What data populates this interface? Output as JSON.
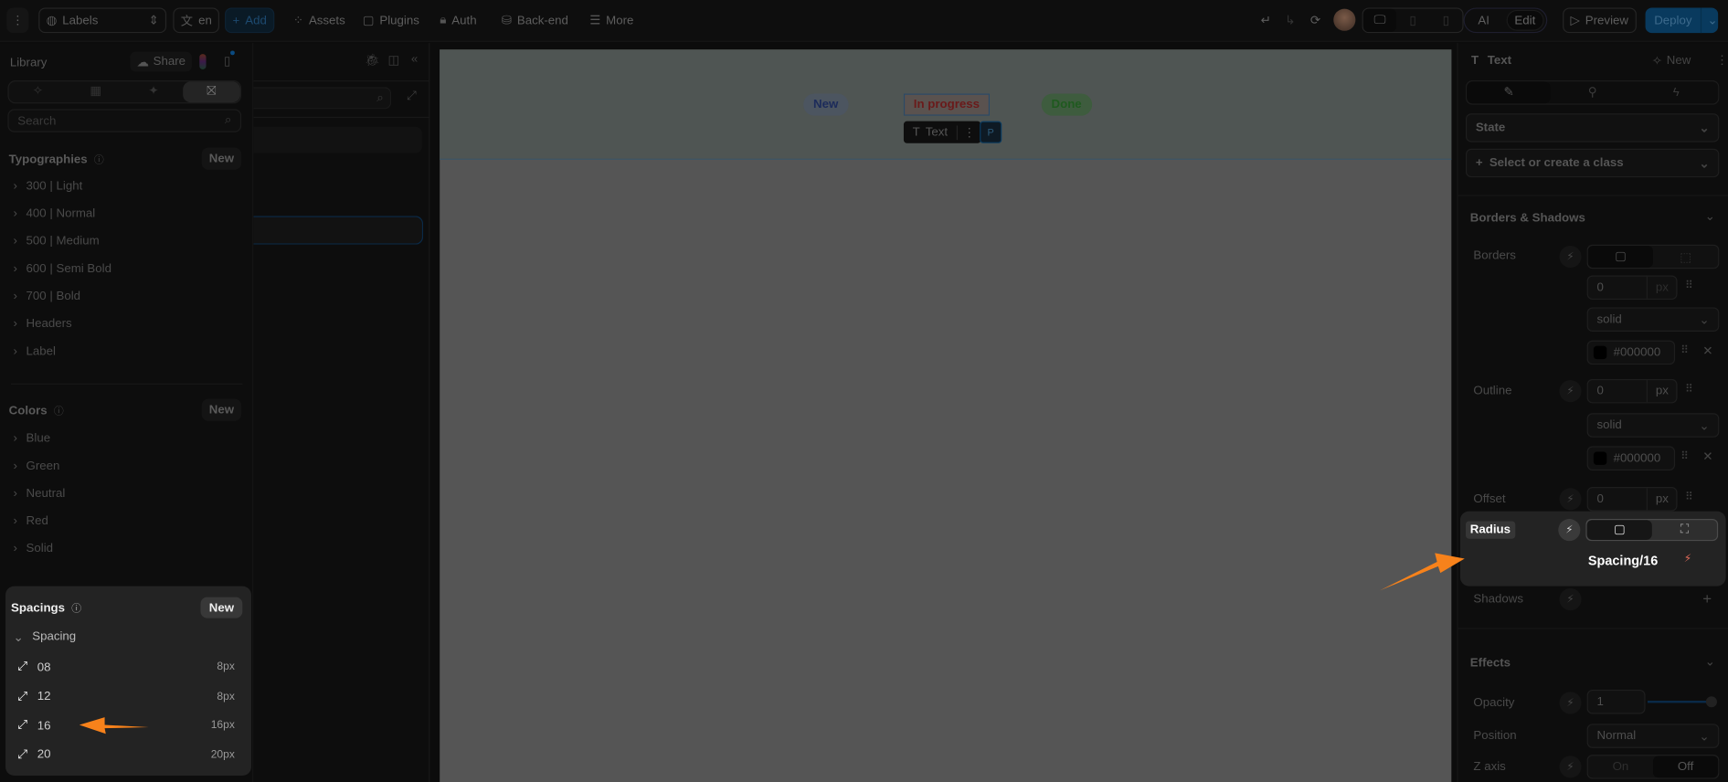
{
  "topbar": {
    "page_select": "Labels",
    "lang": "en",
    "add": "Add",
    "assets": "Assets",
    "plugins": "Plugins",
    "auth": "Auth",
    "backend": "Back-end",
    "more": "More",
    "ai": "AI",
    "edit": "Edit",
    "preview": "Preview",
    "deploy": "Deploy"
  },
  "library": {
    "title": "Library",
    "share": "Share",
    "search_placeholder": "Search",
    "typographies": {
      "title": "Typographies",
      "new": "New",
      "items": [
        "300 | Light",
        "400 | Normal",
        "500 | Medium",
        "600 | Semi Bold",
        "700 | Bold",
        "Headers",
        "Label"
      ]
    },
    "colors": {
      "title": "Colors",
      "new": "New",
      "items": [
        "Blue",
        "Green",
        "Neutral",
        "Red",
        "Solid"
      ]
    },
    "spacings": {
      "title": "Spacings",
      "new": "New",
      "group": "Spacing",
      "items": [
        {
          "name": "08",
          "value": "8px"
        },
        {
          "name": "12",
          "value": "8px"
        },
        {
          "name": "16",
          "value": "16px"
        },
        {
          "name": "20",
          "value": "20px"
        }
      ]
    }
  },
  "canvas": {
    "badges": [
      {
        "label": "New",
        "color": "#1c2b5a"
      },
      {
        "label": "In progress",
        "color": "#6a1a1a"
      },
      {
        "label": "Done",
        "color": "#1f5a1f"
      }
    ],
    "toolbar": {
      "label": "Text",
      "badge": "P"
    }
  },
  "right": {
    "element": "Text",
    "new": "New",
    "state": "State",
    "class_placeholder": "Select or create a class",
    "borders_shadows": "Borders & Shadows",
    "borders": {
      "label": "Borders",
      "width": "0",
      "unit": "px",
      "style": "solid",
      "color": "#000000"
    },
    "outline": {
      "label": "Outline",
      "width": "0",
      "unit": "px",
      "style": "solid",
      "color": "#000000"
    },
    "offset": {
      "label": "Offset",
      "value": "0",
      "unit": "px"
    },
    "radius": {
      "label": "Radius",
      "value": "Spacing/16"
    },
    "shadows": "Shadows",
    "effects": "Effects",
    "opacity": {
      "label": "Opacity",
      "value": "1",
      "level": 1.0
    },
    "position": {
      "label": "Position",
      "value": "Normal"
    },
    "zaxis": {
      "label": "Z axis",
      "on": "On",
      "off": "Off"
    }
  },
  "colors": {
    "accent": "#0a4a80",
    "arrow": "#f7821b",
    "popup": "#232323"
  }
}
